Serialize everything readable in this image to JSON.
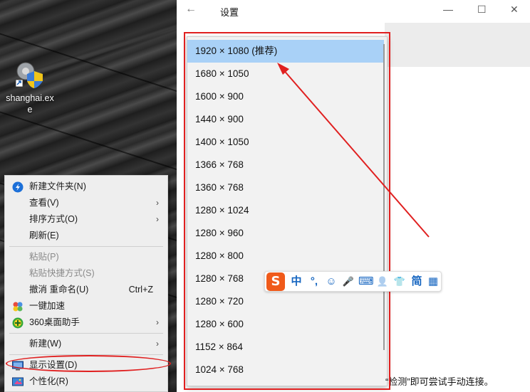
{
  "desktop": {
    "icon_label": "shanghai.exe"
  },
  "context_menu": {
    "items": [
      {
        "label": "新建文件夹(N)",
        "icon": "new-folder-icon",
        "enabled": true
      },
      {
        "label": "查看(V)",
        "submenu": true,
        "enabled": true
      },
      {
        "label": "排序方式(O)",
        "submenu": true,
        "enabled": true
      },
      {
        "label": "刷新(E)",
        "enabled": true
      },
      {
        "label": "粘贴(P)",
        "enabled": false
      },
      {
        "label": "粘贴快捷方式(S)",
        "enabled": false
      },
      {
        "label": "撤消 重命名(U)",
        "shortcut": "Ctrl+Z",
        "enabled": true
      },
      {
        "label": "一键加速",
        "icon": "speedup-icon",
        "enabled": true
      },
      {
        "label": "360桌面助手",
        "icon": "360-icon",
        "submenu": true,
        "enabled": true
      },
      {
        "label": "新建(W)",
        "submenu": true,
        "enabled": true
      },
      {
        "label": "显示设置(D)",
        "icon": "display-icon",
        "enabled": true
      },
      {
        "label": "个性化(R)",
        "icon": "personalize-icon",
        "enabled": true
      }
    ],
    "arrow_glyph": "›"
  },
  "settings": {
    "back": "←",
    "title": "设置",
    "minimize": "—",
    "maximize": "☐",
    "close": "✕",
    "bottom_text": "“检测”即可尝试手动连接。"
  },
  "resolutions": [
    "1920 × 1080 (推荐)",
    "1680 × 1050",
    "1600 × 900",
    "1440 × 900",
    "1400 × 1050",
    "1366 × 768",
    "1360 × 768",
    "1280 × 1024",
    "1280 × 960",
    "1280 × 800",
    "1280 × 768",
    "1280 × 720",
    "1280 × 600",
    "1152 × 864",
    "1024 × 768"
  ],
  "selected_resolution": "1920 × 1080 (推荐)",
  "ime_toolbar": {
    "logo": "S",
    "buttons": [
      "中",
      "°,",
      "☺",
      "🎤",
      "⌨",
      "👤",
      "👕",
      "简",
      "▦"
    ]
  },
  "colors": {
    "annotation_red": "#e02020",
    "selected_bg": "#a9d1f7",
    "ime_orange": "#f05a1a",
    "ime_blue": "#1565c0"
  }
}
